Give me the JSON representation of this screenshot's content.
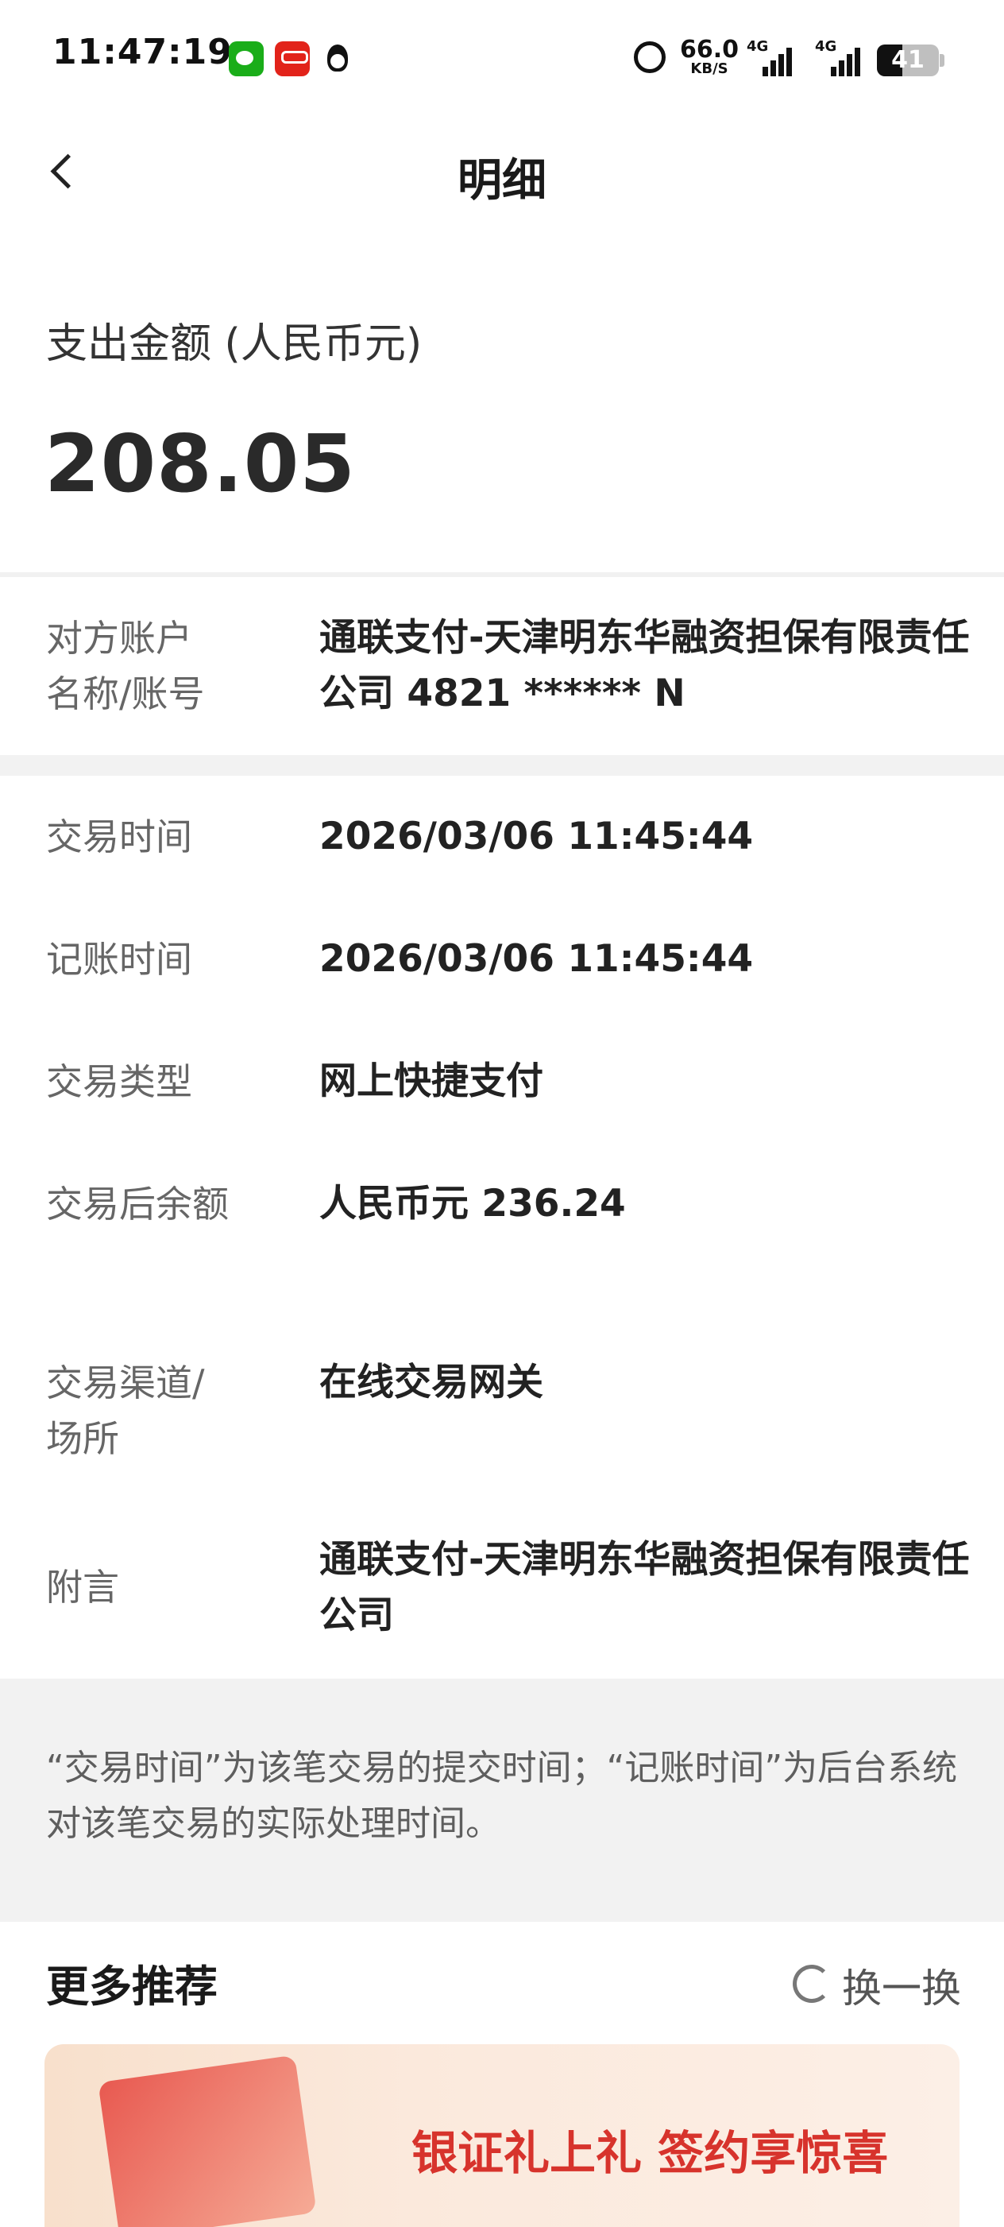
{
  "status_bar": {
    "time": "11:47:19",
    "speed_value": "66.0",
    "speed_unit": "KB/S",
    "signal1_label": "4G",
    "signal2_label": "4G",
    "battery_level": "41",
    "icons": [
      "wechat-icon",
      "unionpay-icon",
      "qq-icon",
      "alarm-icon",
      "signal-icon",
      "battery-icon"
    ]
  },
  "nav": {
    "title": "明细"
  },
  "amount": {
    "label": "支出金额 (人民币元)",
    "value": "208.05"
  },
  "counterparty": {
    "label_line1": "对方账户",
    "label_line2": "名称/账号",
    "value": "通联支付-天津明东华融资担保有限责任公司 4821 ****** N"
  },
  "details": [
    {
      "label": "交易时间",
      "value": "2026/03/06 11:45:44"
    },
    {
      "label": "记账时间",
      "value": "2026/03/06 11:45:44"
    },
    {
      "label": "交易类型",
      "value": "网上快捷支付"
    },
    {
      "label": "交易后余额",
      "value": "人民币元 236.24"
    },
    {
      "label": "交易渠道/场所",
      "value": "在线交易网关"
    },
    {
      "label": "附言",
      "value": "通联支付-天津明东华融资担保有限责任公司"
    }
  ],
  "note": "“交易时间”为该笔交易的提交时间；“记账时间”为后台系统对该笔交易的实际处理时间。",
  "recommend": {
    "title": "更多推荐",
    "refresh_label": "换一换",
    "banner_text": "银证礼上礼 签约享惊喜"
  }
}
